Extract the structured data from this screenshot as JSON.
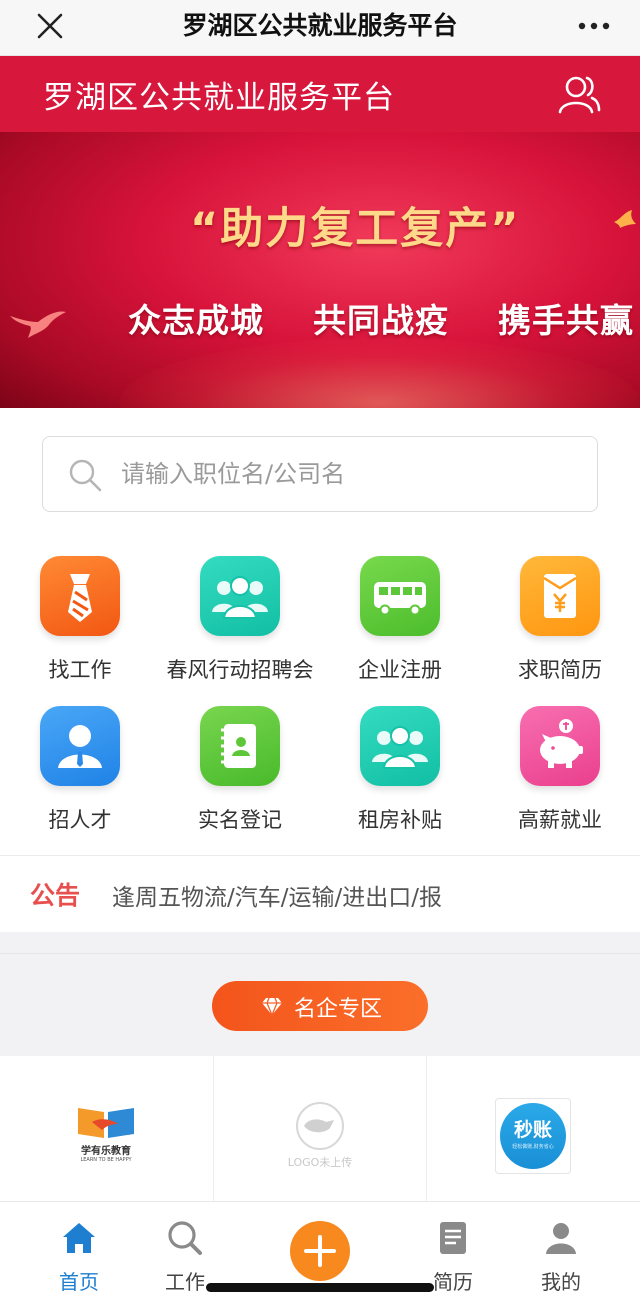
{
  "wechat_bar": {
    "title": "罗湖区公共就业服务平台"
  },
  "header": {
    "title": "罗湖区公共就业服务平台"
  },
  "banner": {
    "quote": "“助力复工复产”",
    "slogan": "众志成城  共同战疫  携手共赢"
  },
  "search": {
    "placeholder": "请输入职位名/公司名"
  },
  "entries": [
    {
      "label": "找工作",
      "icon": "tie-icon",
      "color": "#f5641c"
    },
    {
      "label": "春风行动招聘会",
      "icon": "group-icon",
      "color": "#1ccdb1"
    },
    {
      "label": "企业注册",
      "icon": "bus-icon",
      "color": "#5fcc3a"
    },
    {
      "label": "求职简历",
      "icon": "red-envelope-icon",
      "color": "#ffa21f"
    },
    {
      "label": "招人才",
      "icon": "person-icon",
      "color": "#2a91ee"
    },
    {
      "label": "实名登记",
      "icon": "address-book-icon",
      "color": "#5dc739"
    },
    {
      "label": "租房补贴",
      "icon": "group-icon",
      "color": "#1ccdb1"
    },
    {
      "label": "高薪就业",
      "icon": "piggy-bank-icon",
      "color": "#f0489a"
    }
  ],
  "notice": {
    "tag": "公告",
    "text": "逢周五物流/汽车/运输/进出口/报"
  },
  "famous": {
    "label": "名企专区"
  },
  "logos": [
    {
      "name": "学有乐教育",
      "sub": "LEARN TO BE HAPPY"
    },
    {
      "name": "LOGO未上传"
    },
    {
      "name": "秒账",
      "sub": "轻松做账,财务省心"
    }
  ],
  "tabbar": {
    "items": [
      {
        "label": "首页",
        "icon": "home-icon",
        "active": true
      },
      {
        "label": "工作",
        "icon": "search-icon"
      },
      {
        "label": "",
        "icon": "plus-icon"
      },
      {
        "label": "简历",
        "icon": "document-icon"
      },
      {
        "label": "我的",
        "icon": "user-icon"
      }
    ]
  },
  "colors": {
    "brand_red": "#d8173d",
    "accent_orange": "#f7891f",
    "active_blue": "#1e7fd0"
  }
}
